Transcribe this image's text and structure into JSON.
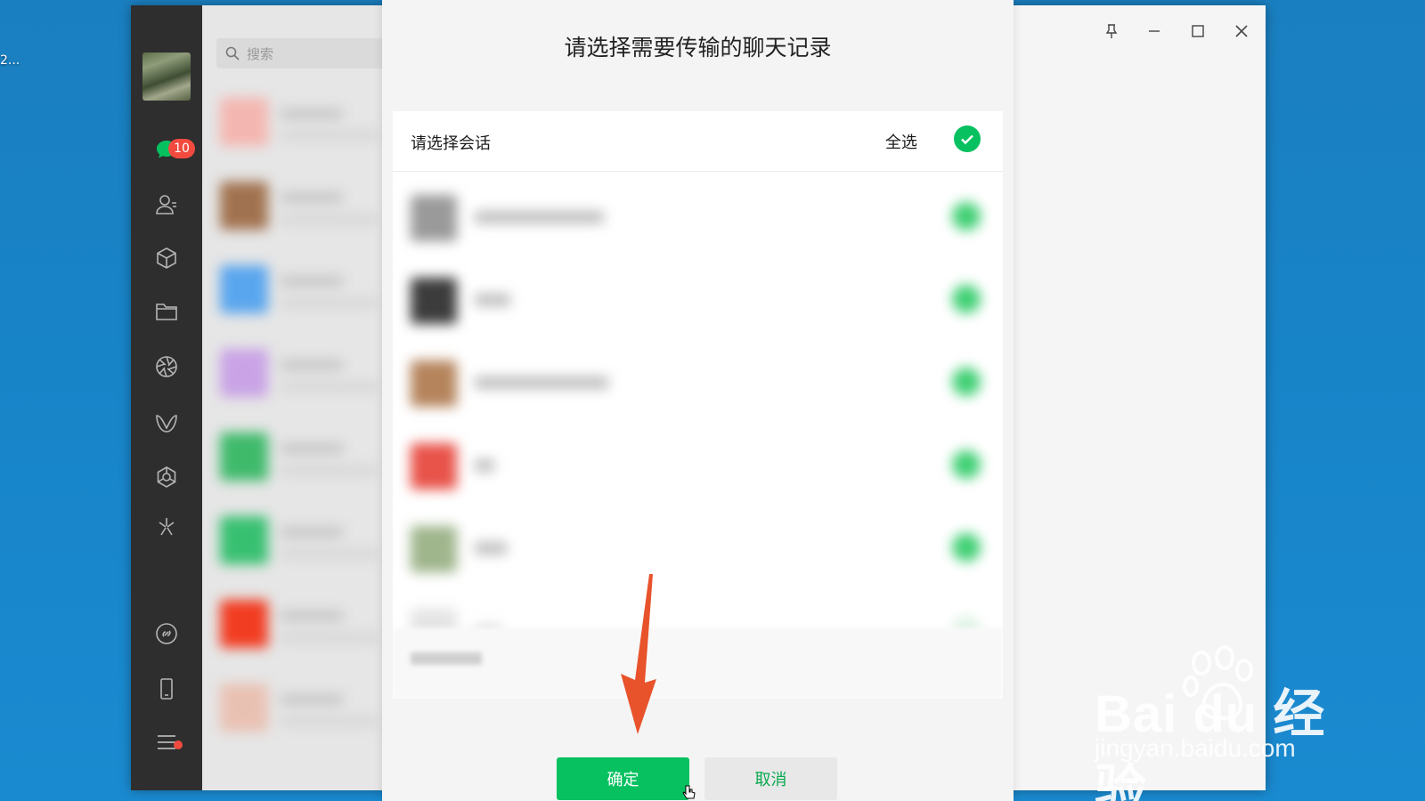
{
  "desktop": {
    "label": "2..."
  },
  "sidebar": {
    "unread_badge": "10",
    "icons": [
      "chat-icon",
      "contacts-icon",
      "favorites-cube-icon",
      "folder-icon",
      "moments-icon",
      "channels-icon",
      "search-hex-icon",
      "mini-program-icon",
      "link-icon",
      "phone-icon",
      "menu-icon"
    ]
  },
  "chatlist": {
    "search_placeholder": "搜索"
  },
  "dialog": {
    "title": "请选择需要传输的聊天记录",
    "panel_label": "请选择会话",
    "select_all_label": "全选",
    "confirm_label": "确定",
    "cancel_label": "取消"
  },
  "watermark": {
    "logo": "Bai du 经验",
    "url": "jingyan.baidu.com"
  },
  "colors": {
    "accent": "#07c160",
    "badge": "#f24a3f",
    "sidebar": "#2e2e2e",
    "arrow": "#e8532c"
  }
}
